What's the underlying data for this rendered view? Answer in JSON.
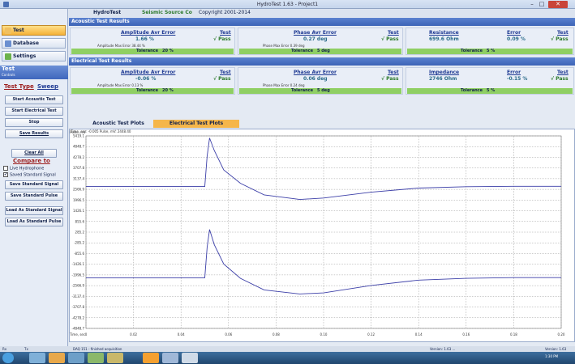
{
  "window": {
    "title": "HydroTest 1.63  -  Project1",
    "minimize": "–",
    "maximize": "□",
    "close": "✕"
  },
  "nav": [
    {
      "label": "Test",
      "icon": "document-icon",
      "color": "#f0c060"
    },
    {
      "label": "Database",
      "icon": "database-icon",
      "color": "#6a8fd0"
    },
    {
      "label": "Settings",
      "icon": "settings-icon",
      "color": "#6cb24a"
    }
  ],
  "left": {
    "header": "Test",
    "subheader": "Controls",
    "tab_test": "Test Type",
    "tab_sweep": "Sweep",
    "buttons": [
      "Start Acoustic Test",
      "Start Electrical Test",
      "Stop",
      "Save Results"
    ],
    "clear_all": "Clear All",
    "compare_to": "Compare to",
    "live_hydrophone": "Live Hydrophone",
    "saved_standard_signal": "Saved Standard Signal",
    "saved_checked": "✔",
    "save_standard_signal": "Save Standard Signal",
    "save_standard_pulse": "Save Standard Pulse",
    "load_standard_signal": "Load As Standard Signal",
    "load_standard_pulse": "Load As Standard Pulse"
  },
  "header": {
    "app": "HydroTest",
    "company": "Seismic Source Co",
    "copyright": "Copyright 2001-2014"
  },
  "acoustic": {
    "section": "Acoustic Test Results",
    "amp": {
      "title": "Amplitude Avr Error",
      "test": "Test",
      "value": "1.66 %",
      "result": "√  Pass",
      "max": "Amplitude Max Error 38.44 %",
      "tol_label": "Tolerance",
      "tol_value": "20 %"
    },
    "phase": {
      "title": "Phase Avr Error",
      "test": "Test",
      "value": "0.27 deg",
      "result": "√  Pass",
      "max": "Phase Max Error 0.39 deg",
      "tol_label": "Tolerance",
      "tol_value": "5 deg"
    },
    "res": {
      "title": "Resistance",
      "error": "Error",
      "test": "Test",
      "value": "699.6 Ohm",
      "err_value": "0.09 %",
      "result": "√  Pass",
      "tol_label": "Tolerance",
      "tol_value": "5 %"
    }
  },
  "electrical": {
    "section": "Electrical Test Results",
    "amp": {
      "title": "Amplitude Avr Error",
      "test": "Test",
      "value": "-0.06 %",
      "result": "√  Pass",
      "max": "Amplitude Max Error 0.13 %",
      "tol_label": "Tolerance",
      "tol_value": "20 %"
    },
    "phase": {
      "title": "Phase Avr Error",
      "test": "Test",
      "value": "0.06 deg",
      "result": "√  Pass",
      "max": "Phase Max Error 0.24 deg",
      "tol_label": "Tolerance",
      "tol_value": "5 deg"
    },
    "imp": {
      "title": "Impedance",
      "error": "Error",
      "test": "Test",
      "value": "2746 Ohm",
      "err_value": "-0.15 %",
      "result": "√  Pass",
      "tol_label": "Tolerance",
      "tol_value": "5 %"
    }
  },
  "plots": {
    "tab_acoustic": "Acoustic Test Plots",
    "tab_electrical": "Electrical Test Plots",
    "active_color": "#f5b64a",
    "readout": "Time, sec: -0.005   Pulse, mV: 2448.40",
    "ylabel": "Pulse, mV",
    "xlabel": "Time, sec",
    "y_ticks": [
      "5419.1",
      "4848.7",
      "4278.2",
      "3707.8",
      "3137.4",
      "2566.9",
      "1996.5",
      "1426.1",
      "855.6",
      "285.2",
      "-285.2",
      "-855.6",
      "-1426.1",
      "-1996.5",
      "-2566.9",
      "-3137.4",
      "-3707.8",
      "-4278.2",
      "-4848.7"
    ],
    "x_ticks": [
      "0",
      "0.02",
      "0.04",
      "0.06",
      "0.08",
      "0.10",
      "0.12",
      "0.14",
      "0.16",
      "0.18",
      "0.20"
    ],
    "line_color": "#3c3fa8"
  },
  "chart_data": {
    "type": "line",
    "xlabel": "Time, sec",
    "ylabel": "Pulse, mV",
    "xlim": [
      0,
      0.2
    ],
    "ylim": [
      -5419.1,
      5419.1
    ],
    "grid": true,
    "series": [
      {
        "x": [
          0,
          0.05,
          0.051,
          0.052,
          0.054,
          0.058,
          0.065,
          0.075,
          0.09,
          0.1,
          0.12,
          0.14,
          0.16,
          0.18,
          0.2
        ],
        "y": [
          2566.9,
          2566.9,
          4278.2,
          5300,
          4600,
          3500,
          2750,
          2100,
          1840,
          1920,
          2250,
          2480,
          2560,
          2580,
          2580
        ]
      },
      {
        "x": [
          0,
          0.05,
          0.051,
          0.052,
          0.054,
          0.058,
          0.065,
          0.075,
          0.09,
          0.1,
          0.12,
          0.14,
          0.16,
          0.18,
          0.2
        ],
        "y": [
          -2566.9,
          -2566.9,
          -855.6,
          150,
          -700,
          -1800,
          -2600,
          -3250,
          -3480,
          -3420,
          -3000,
          -2700,
          -2600,
          -2560,
          -2560
        ]
      }
    ]
  },
  "status": {
    "left1": "Rx",
    "left2": "Tx",
    "daq": "DAQ 151 - finished acquisition",
    "version_mid": "Version: 1.63 ...",
    "version_right": "Version: 1.63"
  },
  "taskbar": {
    "clock": "1:30 PM"
  }
}
